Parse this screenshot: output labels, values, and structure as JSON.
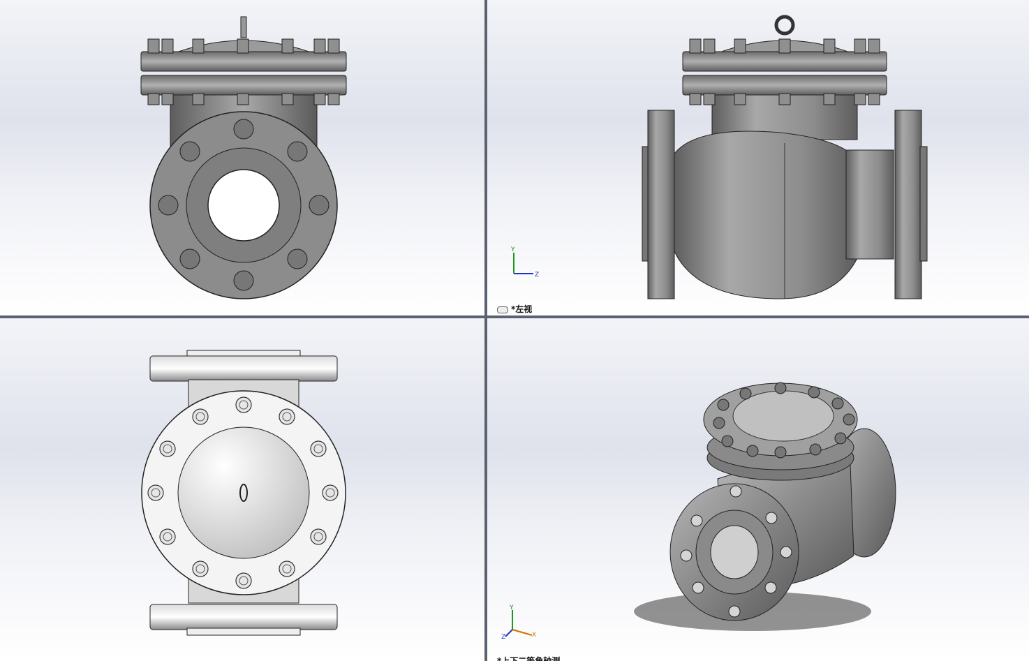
{
  "viewports": [
    {
      "id": "front",
      "label": ""
    },
    {
      "id": "left",
      "label": "*左视"
    },
    {
      "id": "top",
      "label": ""
    },
    {
      "id": "iso",
      "label": "*上下二等角轴测"
    }
  ],
  "triad": {
    "y": "Y",
    "z": "Z",
    "x": "X"
  },
  "colors": {
    "background_top": "#dfe2ec",
    "metal": "#8a8a8a",
    "frame": "#5a6270"
  }
}
